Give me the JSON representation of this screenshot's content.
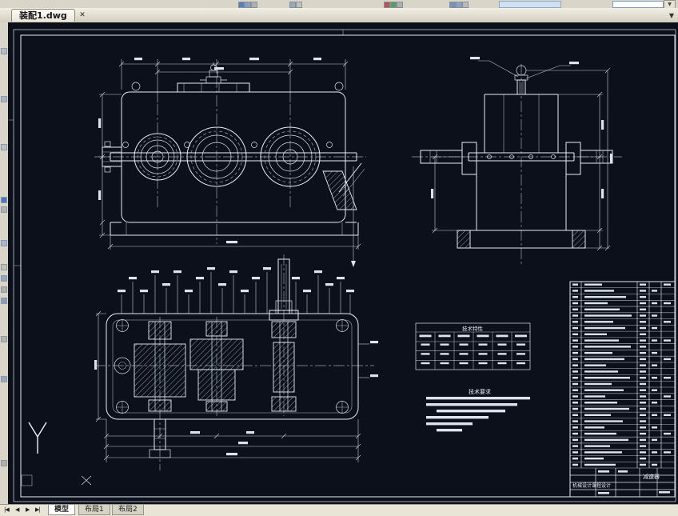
{
  "titlebar": {
    "document_tab": "装配1.dwg",
    "close_label": "✕",
    "tab_list_arrow": "▼",
    "toolbar_dropdown_arrow": "▼"
  },
  "drawing": {
    "tech_spec_title": "技术特性",
    "tech_req_title": "技术要求",
    "title_block": {
      "project": "机械设计课程设计",
      "part_name": "减速器"
    }
  },
  "statusbar": {
    "nav": [
      "|◀",
      "◀",
      "▶",
      "▶|"
    ],
    "tabs": [
      {
        "label": "模型",
        "active": true
      },
      {
        "label": "布局1",
        "active": false
      },
      {
        "label": "布局2",
        "active": false
      }
    ]
  },
  "colors": {
    "canvas_bg": "#0b101b",
    "line": "#e8ecf4",
    "chrome": "#d8d4c8"
  }
}
